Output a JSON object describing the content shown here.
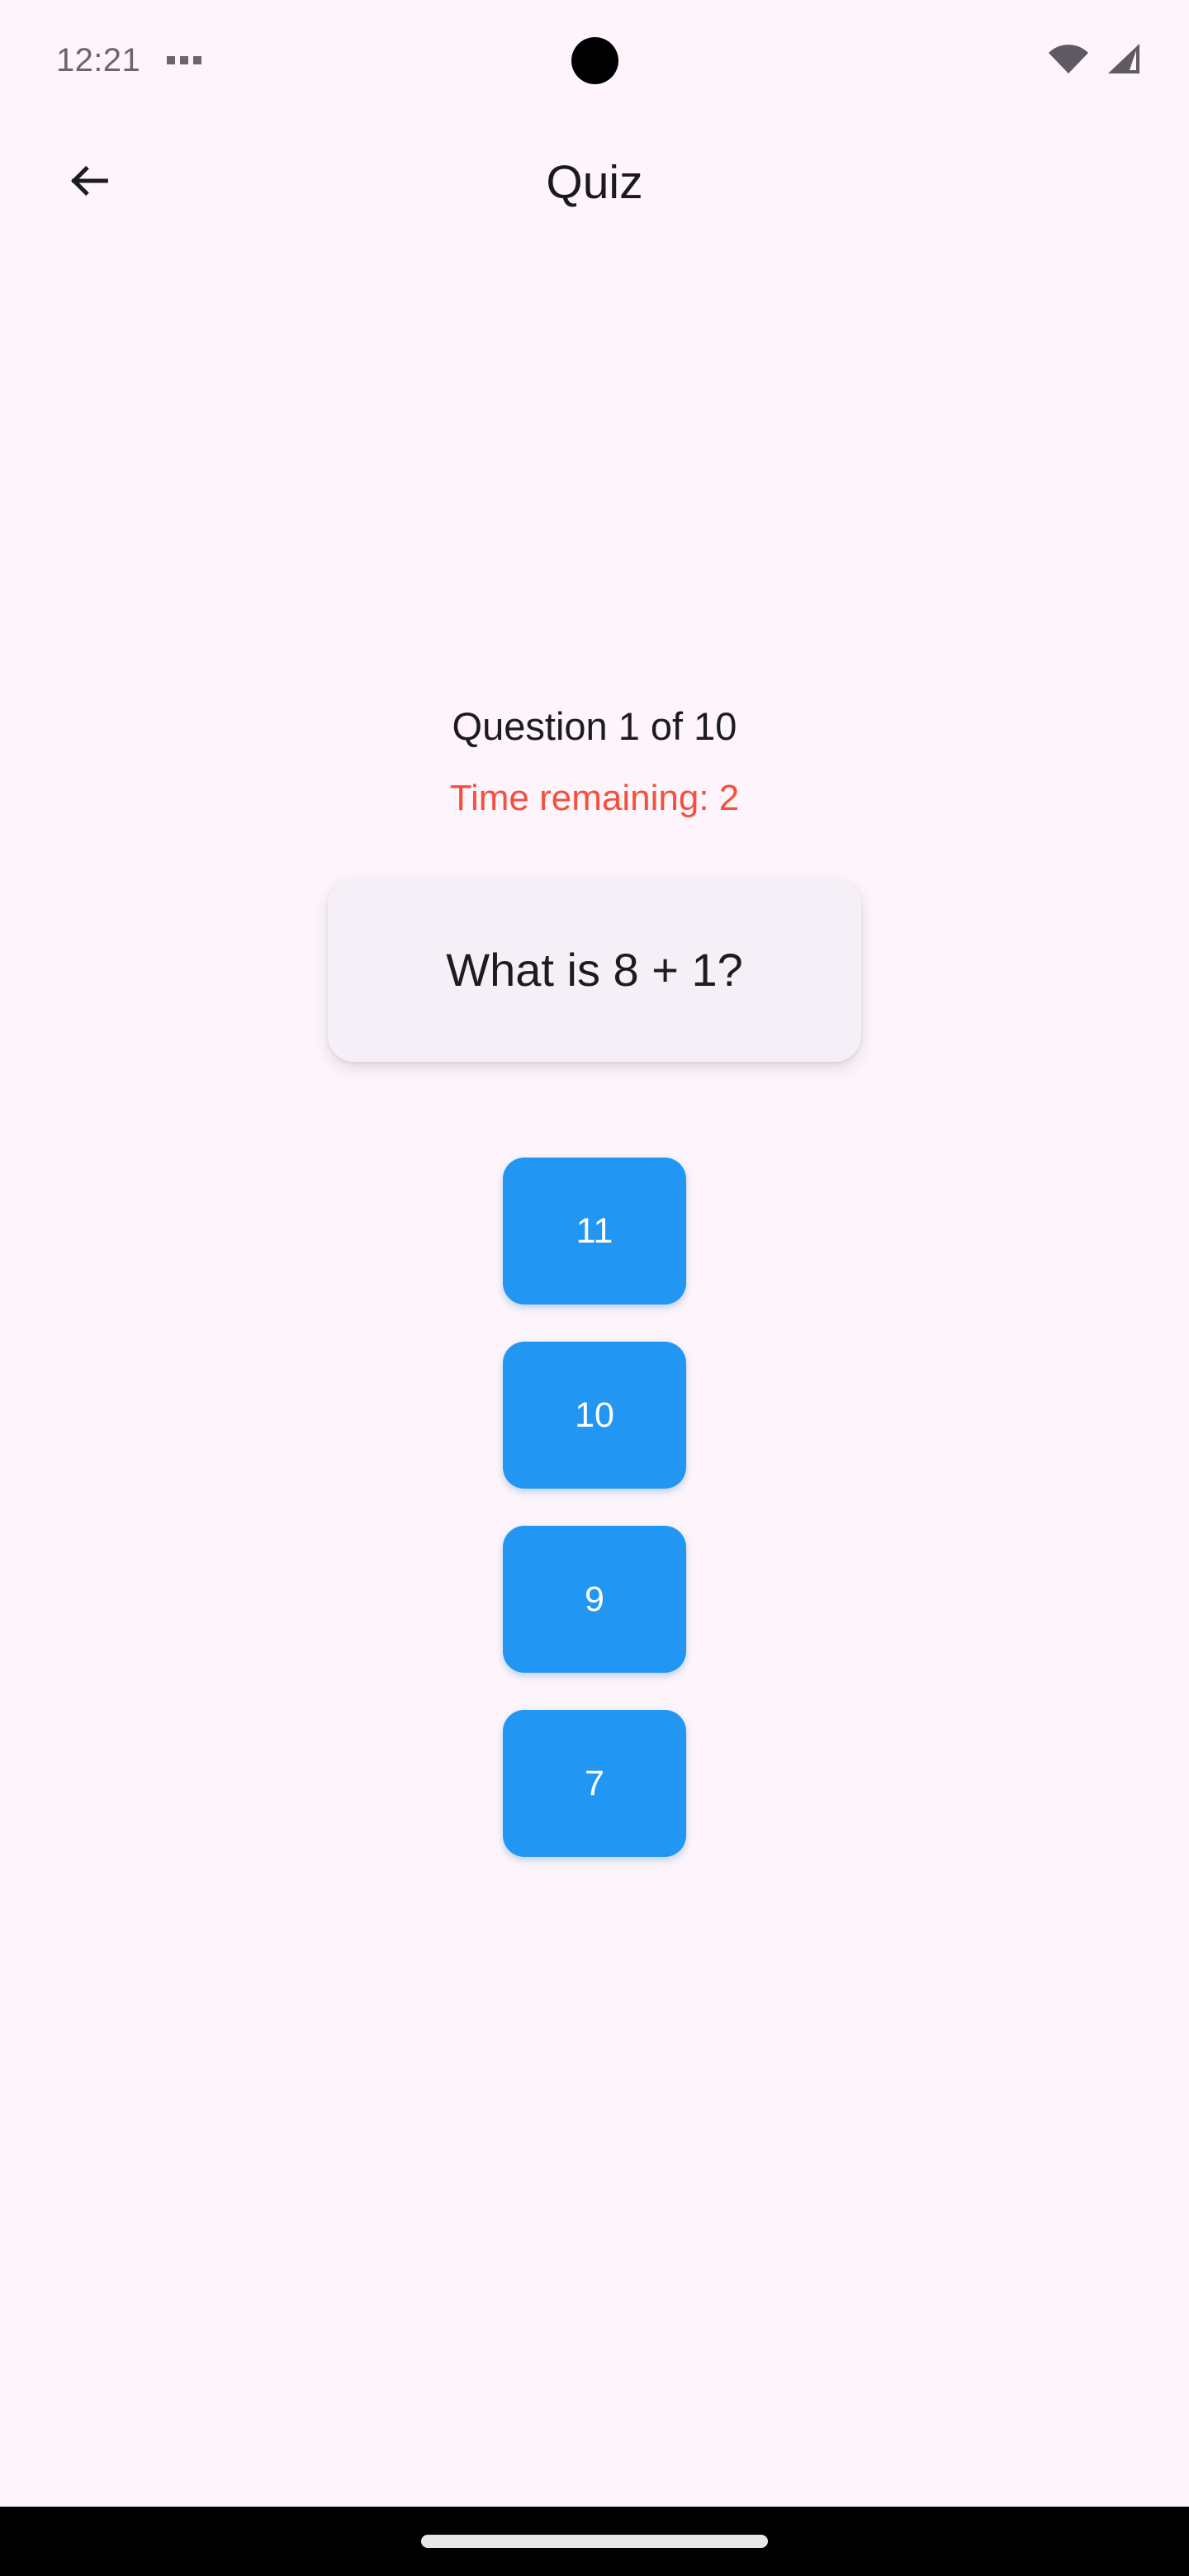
{
  "status_bar": {
    "time": "12:21",
    "notification_dots_count": 3,
    "icons": [
      "wifi-icon",
      "cellular-signal-icon"
    ],
    "text_color": "#6B6570"
  },
  "header": {
    "back_icon": "arrow-left-icon",
    "title": "Quiz"
  },
  "quiz": {
    "progress_label": "Question 1 of 10",
    "current_question": 1,
    "total_questions": 10,
    "timer_label": "Time remaining: 2",
    "time_remaining": 2,
    "timer_color": "#F4503C",
    "question_text": "What is 8 + 1?",
    "card_background": "#F5F0F7",
    "answers": [
      {
        "label": "11"
      },
      {
        "label": "10"
      },
      {
        "label": "9"
      },
      {
        "label": "7"
      }
    ],
    "answer_color": "#2196F3",
    "answer_text_color": "#FFFFFF"
  },
  "nav_bar": {
    "home_indicator": "home-indicator-pill",
    "background": "#000000"
  },
  "theme": {
    "page_background": "#FDF5FB",
    "text_primary": "#1C1B1F"
  }
}
